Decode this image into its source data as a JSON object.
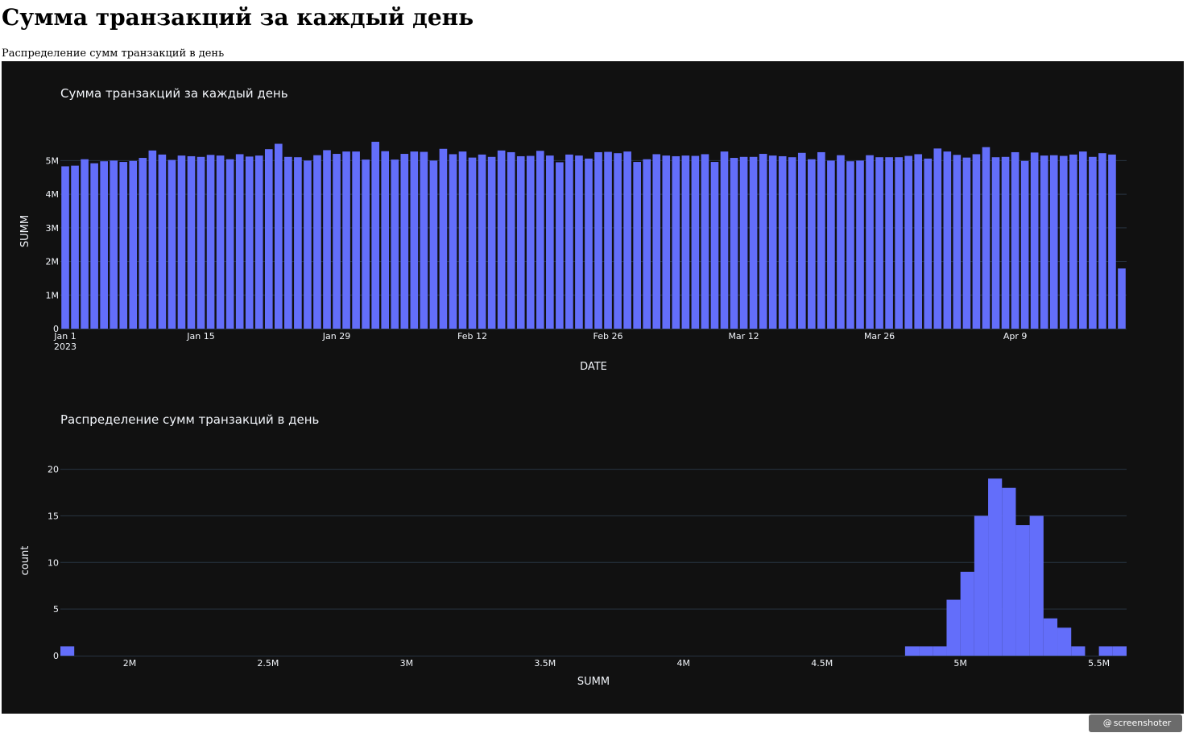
{
  "page": {
    "heading": "Сумма транзакций за каждый день",
    "subheading": "Распределение сумм транзакций в день",
    "watermark": "screenshoter",
    "watermark_icon": "at-sign-icon"
  },
  "colors": {
    "panel_bg": "#111111",
    "bar": "#636efa",
    "grid": "#283442",
    "text": "#f2f5fa",
    "axis_text": "#f2f5fa"
  },
  "chart_data": [
    {
      "type": "bar",
      "title": "Сумма транзакций за каждый день",
      "xlabel": "DATE",
      "ylabel": "SUMM",
      "x_start": "2023-01-01",
      "x_end": "2023-04-20",
      "x_ticks": [
        {
          "label": "Jan 1",
          "sub": "2023",
          "date": "2023-01-01"
        },
        {
          "label": "Jan 15",
          "date": "2023-01-15"
        },
        {
          "label": "Jan 29",
          "date": "2023-01-29"
        },
        {
          "label": "Feb 12",
          "date": "2023-02-12"
        },
        {
          "label": "Feb 26",
          "date": "2023-02-26"
        },
        {
          "label": "Mar 12",
          "date": "2023-03-12"
        },
        {
          "label": "Mar 26",
          "date": "2023-03-26"
        },
        {
          "label": "Apr 9",
          "date": "2023-04-09"
        }
      ],
      "y_ticks": [
        {
          "label": "0",
          "value": 0
        },
        {
          "label": "1M",
          "value": 1000000
        },
        {
          "label": "2M",
          "value": 2000000
        },
        {
          "label": "3M",
          "value": 3000000
        },
        {
          "label": "4M",
          "value": 4000000
        },
        {
          "label": "5M",
          "value": 5000000
        }
      ],
      "ylim": [
        0,
        5800000
      ],
      "grid": true,
      "values": [
        4830000,
        4850000,
        5040000,
        4920000,
        4980000,
        5000000,
        4960000,
        4990000,
        5080000,
        5300000,
        5180000,
        5020000,
        5150000,
        5130000,
        5110000,
        5170000,
        5150000,
        5040000,
        5190000,
        5120000,
        5150000,
        5340000,
        5500000,
        5110000,
        5100000,
        5000000,
        5160000,
        5310000,
        5200000,
        5270000,
        5270000,
        5030000,
        5560000,
        5280000,
        5030000,
        5200000,
        5270000,
        5260000,
        5000000,
        5350000,
        5190000,
        5270000,
        5090000,
        5180000,
        5110000,
        5300000,
        5250000,
        5130000,
        5140000,
        5290000,
        5150000,
        4950000,
        5180000,
        5150000,
        5060000,
        5250000,
        5260000,
        5220000,
        5270000,
        4960000,
        5040000,
        5190000,
        5150000,
        5130000,
        5150000,
        5140000,
        5190000,
        4960000,
        5270000,
        5080000,
        5110000,
        5110000,
        5200000,
        5150000,
        5130000,
        5100000,
        5230000,
        5040000,
        5250000,
        5000000,
        5160000,
        4980000,
        5000000,
        5160000,
        5100000,
        5100000,
        5100000,
        5140000,
        5190000,
        5060000,
        5360000,
        5270000,
        5170000,
        5090000,
        5190000,
        5400000,
        5100000,
        5110000,
        5250000,
        4990000,
        5240000,
        5150000,
        5160000,
        5140000,
        5180000,
        5270000,
        5110000,
        5220000,
        5180000,
        1790000
      ]
    },
    {
      "type": "bar",
      "title": "Распределение сумм транзакций в день",
      "xlabel": "SUMM",
      "ylabel": "count",
      "xlim": [
        1750000,
        5600000
      ],
      "x_ticks": [
        {
          "label": "2M",
          "value": 2000000
        },
        {
          "label": "2.5M",
          "value": 2500000
        },
        {
          "label": "3M",
          "value": 3000000
        },
        {
          "label": "3.5M",
          "value": 3500000
        },
        {
          "label": "4M",
          "value": 4000000
        },
        {
          "label": "4.5M",
          "value": 4500000
        },
        {
          "label": "5M",
          "value": 5000000
        },
        {
          "label": "5.5M",
          "value": 5500000
        }
      ],
      "y_ticks": [
        {
          "label": "0",
          "value": 0
        },
        {
          "label": "5",
          "value": 5
        },
        {
          "label": "10",
          "value": 10
        },
        {
          "label": "15",
          "value": 15
        },
        {
          "label": "20",
          "value": 20
        }
      ],
      "ylim": [
        0,
        21
      ],
      "grid": true,
      "bins": [
        {
          "x0": 1750000,
          "x1": 1800000,
          "count": 1
        },
        {
          "x0": 4800000,
          "x1": 4850000,
          "count": 1
        },
        {
          "x0": 4850000,
          "x1": 4900000,
          "count": 1
        },
        {
          "x0": 4900000,
          "x1": 4950000,
          "count": 1
        },
        {
          "x0": 4950000,
          "x1": 5000000,
          "count": 6
        },
        {
          "x0": 5000000,
          "x1": 5050000,
          "count": 9
        },
        {
          "x0": 5050000,
          "x1": 5100000,
          "count": 15
        },
        {
          "x0": 5100000,
          "x1": 5150000,
          "count": 19
        },
        {
          "x0": 5150000,
          "x1": 5200000,
          "count": 18
        },
        {
          "x0": 5200000,
          "x1": 5250000,
          "count": 14
        },
        {
          "x0": 5250000,
          "x1": 5300000,
          "count": 15
        },
        {
          "x0": 5300000,
          "x1": 5350000,
          "count": 4
        },
        {
          "x0": 5350000,
          "x1": 5400000,
          "count": 3
        },
        {
          "x0": 5400000,
          "x1": 5450000,
          "count": 1
        },
        {
          "x0": 5500000,
          "x1": 5550000,
          "count": 1
        },
        {
          "x0": 5550000,
          "x1": 5600000,
          "count": 1
        }
      ]
    }
  ]
}
